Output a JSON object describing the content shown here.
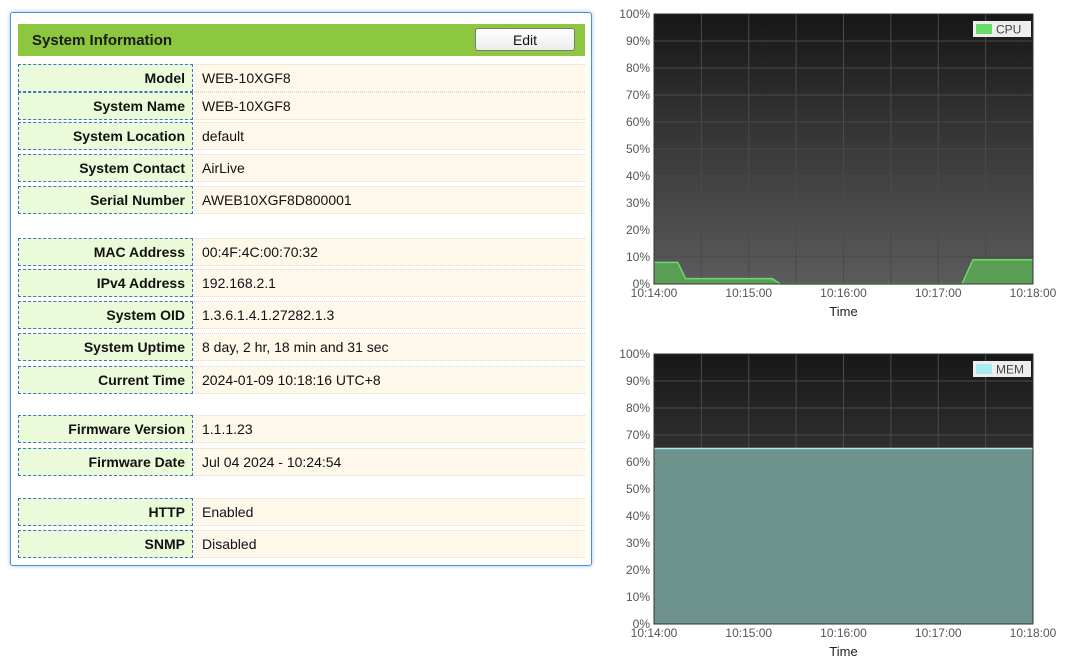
{
  "system_information": {
    "title": "System Information",
    "edit_label": "Edit",
    "rows": [
      {
        "label": "Model",
        "value": "WEB-10XGF8"
      },
      {
        "label": "System Name",
        "value": "WEB-10XGF8"
      },
      {
        "label": "System Location",
        "value": "default"
      },
      {
        "label": "System Contact",
        "value": "AirLive"
      },
      {
        "label": "Serial Number",
        "value": "AWEB10XGF8D800001"
      },
      {
        "label": "MAC Address",
        "value": "00:4F:4C:00:70:32"
      },
      {
        "label": "IPv4 Address",
        "value": "192.168.2.1"
      },
      {
        "label": "System OID",
        "value": "1.3.6.1.4.1.27282.1.3"
      },
      {
        "label": "System Uptime",
        "value": "8 day, 2 hr, 18 min and 31 sec"
      },
      {
        "label": "Current Time",
        "value": "2024-01-09 10:18:16 UTC+8"
      },
      {
        "label": "Firmware Version",
        "value": "1.1.1.23"
      },
      {
        "label": "Firmware Date",
        "value": "Jul 04 2024 - 10:24:54"
      },
      {
        "label": "HTTP",
        "value": "Enabled"
      },
      {
        "label": "SNMP",
        "value": "Disabled"
      }
    ]
  },
  "chart_data": [
    {
      "type": "area",
      "xlabel": "Time",
      "x_ticks": [
        "10:14:00",
        "10:15:00",
        "10:16:00",
        "10:17:00",
        "10:18:00"
      ],
      "y_ticks": [
        "0%",
        "10%",
        "20%",
        "30%",
        "40%",
        "50%",
        "60%",
        "70%",
        "80%",
        "90%",
        "100%"
      ],
      "ylim": [
        0,
        100
      ],
      "xlim": [
        "10:14:00",
        "10:18:00"
      ],
      "grid": true,
      "legend_position": "top-right",
      "series": [
        {
          "name": "CPU",
          "color": "#66dd66",
          "fill": "#5a9e55",
          "points": [
            [
              "10:14:00",
              8
            ],
            [
              "10:14:15",
              8
            ],
            [
              "10:14:20",
              2
            ],
            [
              "10:15:15",
              2
            ],
            [
              "10:15:20",
              0
            ],
            [
              "10:17:15",
              0
            ],
            [
              "10:17:22",
              9
            ],
            [
              "10:18:00",
              9
            ]
          ]
        }
      ]
    },
    {
      "type": "area",
      "xlabel": "Time",
      "x_ticks": [
        "10:14:00",
        "10:15:00",
        "10:16:00",
        "10:17:00",
        "10:18:00"
      ],
      "y_ticks": [
        "0%",
        "10%",
        "20%",
        "30%",
        "40%",
        "50%",
        "60%",
        "70%",
        "80%",
        "90%",
        "100%"
      ],
      "ylim": [
        0,
        100
      ],
      "xlim": [
        "10:14:00",
        "10:18:00"
      ],
      "grid": true,
      "legend_position": "top-right",
      "series": [
        {
          "name": "MEM",
          "color": "#a8ecf0",
          "fill": "#6e938c",
          "points": [
            [
              "10:14:00",
              65
            ],
            [
              "10:18:00",
              65
            ]
          ]
        }
      ]
    }
  ]
}
